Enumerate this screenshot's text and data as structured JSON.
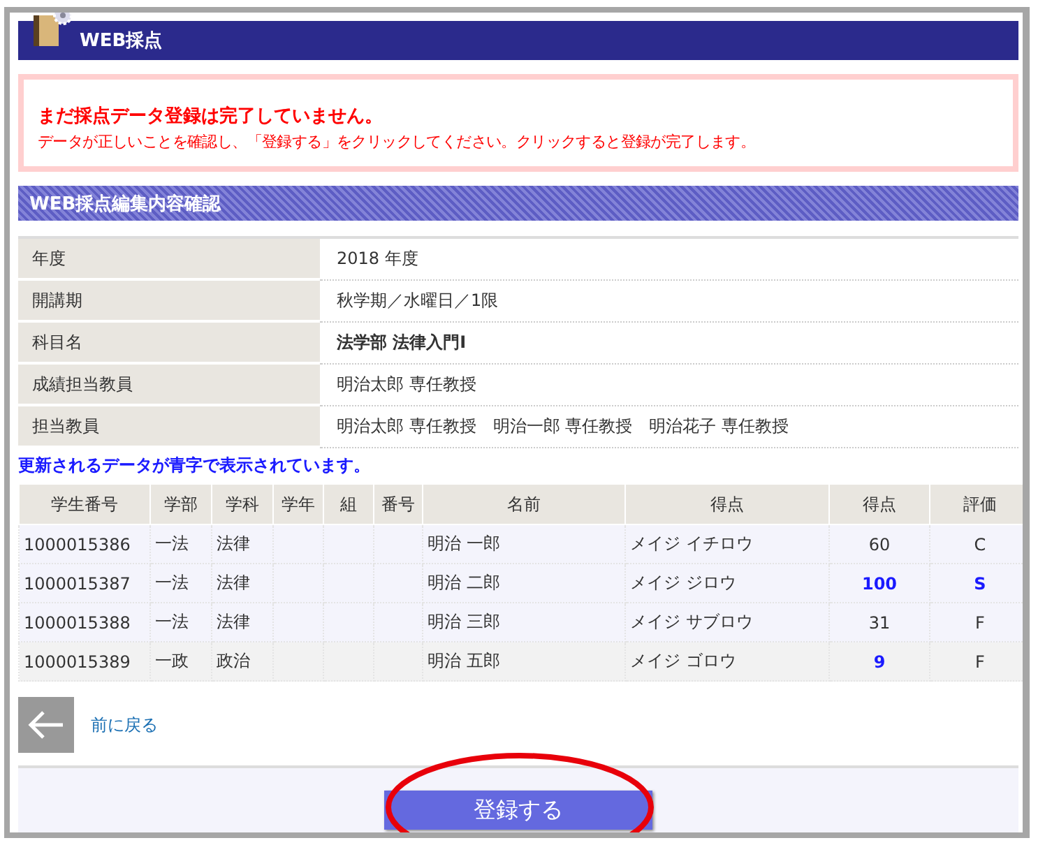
{
  "header": {
    "title": "WEB採点"
  },
  "notice": {
    "heading": "まだ採点データ登録は完了していません。",
    "body": "データが正しいことを確認し、「登録する」をクリックしてください。クリックすると登録が完了します。"
  },
  "section": {
    "title": "WEB採点編集内容確認"
  },
  "info": [
    {
      "label": "年度",
      "value": "2018 年度",
      "bold": false
    },
    {
      "label": "開講期",
      "value": "秋学期／水曜日／1限",
      "bold": false
    },
    {
      "label": "科目名",
      "value": "法学部 法律入門Ⅰ",
      "bold": true
    },
    {
      "label": "成績担当教員",
      "value": "明治太郎 専任教授",
      "bold": false
    },
    {
      "label": "担当教員",
      "value": "明治太郎 専任教授　明治一郎 専任教授　明治花子 専任教授",
      "bold": false
    }
  ],
  "update_note": "更新されるデータが青字で表示されています。",
  "table": {
    "columns": [
      "学生番号",
      "学部",
      "学科",
      "学年",
      "組",
      "番号",
      "名前",
      "得点",
      "得点",
      "評価"
    ],
    "rows": [
      {
        "student_no": "1000015386",
        "faculty": "一法",
        "department": "法律",
        "name": "明治 一郎",
        "kana": "メイジ イチロウ",
        "score": "60",
        "score_updated": false,
        "grade": "C",
        "grade_updated": false
      },
      {
        "student_no": "1000015387",
        "faculty": "一法",
        "department": "法律",
        "name": "明治 二郎",
        "kana": "メイジ ジロウ",
        "score": "100",
        "score_updated": true,
        "grade": "S",
        "grade_updated": true
      },
      {
        "student_no": "1000015388",
        "faculty": "一法",
        "department": "法律",
        "name": "明治 三郎",
        "kana": "メイジ サブロウ",
        "score": "31",
        "score_updated": false,
        "grade": "F",
        "grade_updated": false
      },
      {
        "student_no": "1000015389",
        "faculty": "一政",
        "department": "政治",
        "name": "明治 五郎",
        "kana": "メイジ ゴロウ",
        "score": "9",
        "score_updated": true,
        "grade": "F",
        "grade_updated": false
      }
    ]
  },
  "back_link": "前に戻る",
  "submit_button": "登録する"
}
